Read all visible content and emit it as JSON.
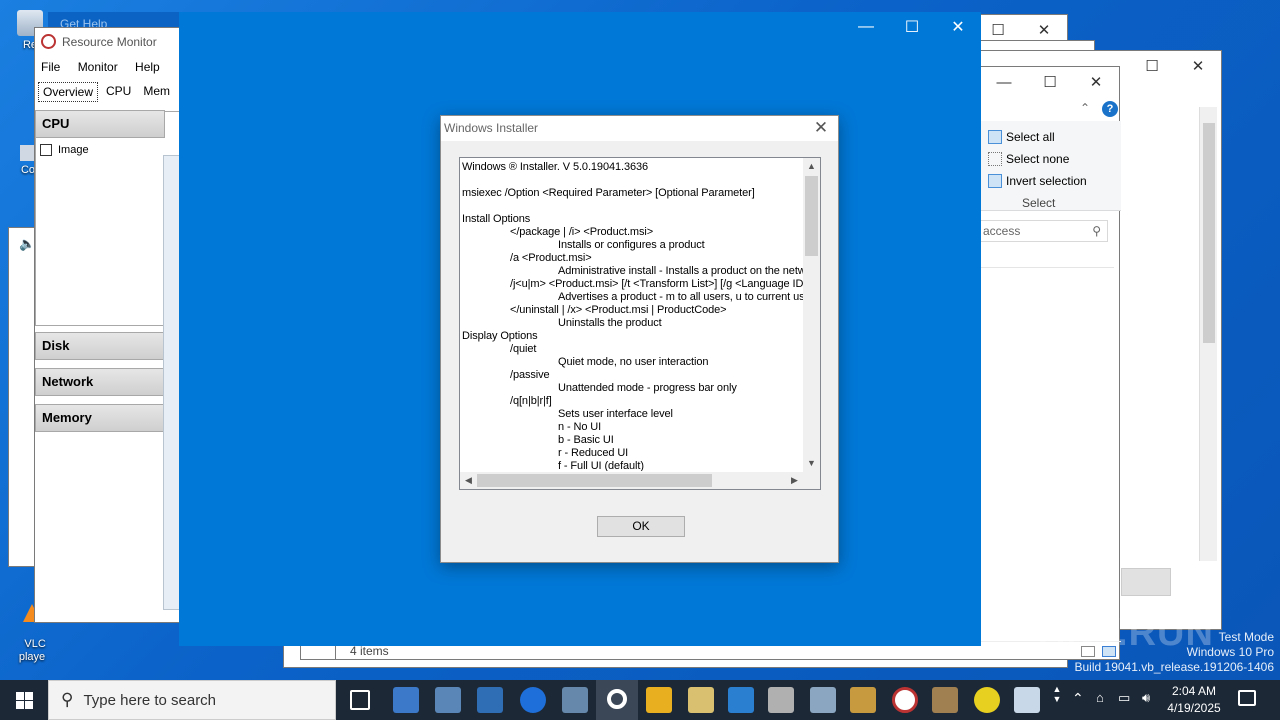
{
  "desktop": {
    "icons": [
      {
        "label": "Re"
      },
      {
        "label": "Co"
      },
      {
        "label": "VLC\nplaye"
      }
    ]
  },
  "resource_monitor": {
    "title": "Resource Monitor",
    "menu": [
      "File",
      "Monitor",
      "Help"
    ],
    "tabs": [
      "Overview",
      "CPU",
      "Mem"
    ],
    "sections": [
      "CPU",
      "Disk",
      "Network",
      "Memory"
    ],
    "cpu_column": "Image"
  },
  "get_help_title": "Get Help",
  "explorer": {
    "select_all": "Select all",
    "select_none": "Select none",
    "invert_selection": "Invert selection",
    "group_label": "Select",
    "search_placeholder": "access",
    "status_items": "4 items"
  },
  "dialog": {
    "title": "Windows Installer",
    "ok_label": "OK",
    "lines": [
      "Windows ® Installer. V 5.0.19041.3636",
      "",
      "msiexec /Option <Required Parameter> [Optional Parameter]",
      "",
      "Install Options",
      "\t</package | /i> <Product.msi>",
      "\t\tInstalls or configures a product",
      "\t/a <Product.msi>",
      "\t\tAdministrative install - Installs a product on the netw",
      "\t/j<u|m> <Product.msi> [/t <Transform List>] [/g <Language ID",
      "\t\tAdvertises a product - m to all users, u to current use",
      "\t</uninstall | /x> <Product.msi | ProductCode>",
      "\t\tUninstalls the product",
      "Display Options",
      "\t/quiet",
      "\t\tQuiet mode, no user interaction",
      "\t/passive",
      "\t\tUnattended mode - progress bar only",
      "\t/q[n|b|r|f]",
      "\t\tSets user interface level",
      "\t\tn - No UI",
      "\t\tb - Basic UI",
      "\t\tr - Reduced UI",
      "\t\tf - Full UI (default)"
    ]
  },
  "taskbar": {
    "search_placeholder": "Type here to search",
    "time": "2:04 AM",
    "date": "4/19/2025"
  },
  "watermark": {
    "brand": "ANY.RUN",
    "line1": "Test Mode",
    "line2": "Windows 10 Pro",
    "line3": "Build 19041.vb_release.191206-1406"
  },
  "colors": {
    "blue_window": "#0078d7",
    "taskbar": "#1c2836",
    "desktop": "#0a6fd1"
  }
}
